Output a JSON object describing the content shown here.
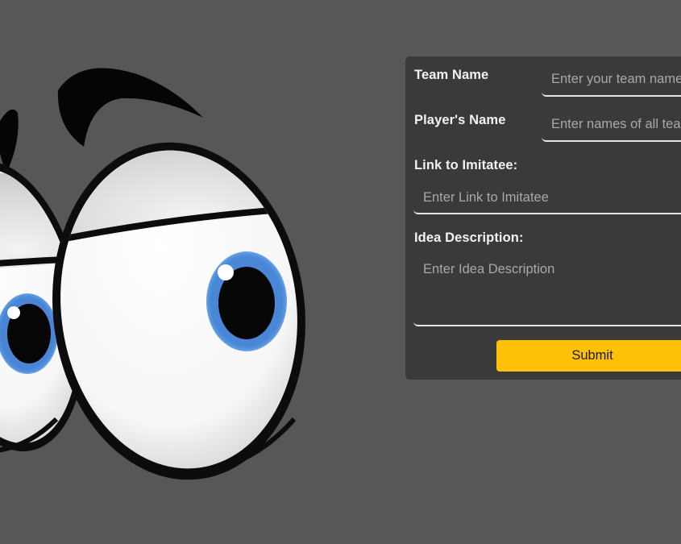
{
  "form": {
    "team_name": {
      "label": "Team Name",
      "placeholder": "Enter your team name",
      "value": ""
    },
    "players_name": {
      "label": "Player's Name",
      "placeholder": "Enter names of all team members",
      "value": ""
    },
    "imitatee_link": {
      "label": "Link to Imitatee:",
      "placeholder": "Enter Link to Imitatee",
      "value": ""
    },
    "idea_description": {
      "label": "Idea Description:",
      "placeholder": "Enter Idea Description",
      "value": ""
    },
    "submit_label": "Submit"
  },
  "colors": {
    "page_background": "#575757",
    "panel_background": "#3a3a3a",
    "accent_button": "#ffc107",
    "label_text": "#f2f2f2",
    "placeholder_text": "#a9a9a9",
    "iris_blue": "#3f7fd0"
  },
  "illustration": {
    "icon": "cartoon-eyes-illustration"
  }
}
